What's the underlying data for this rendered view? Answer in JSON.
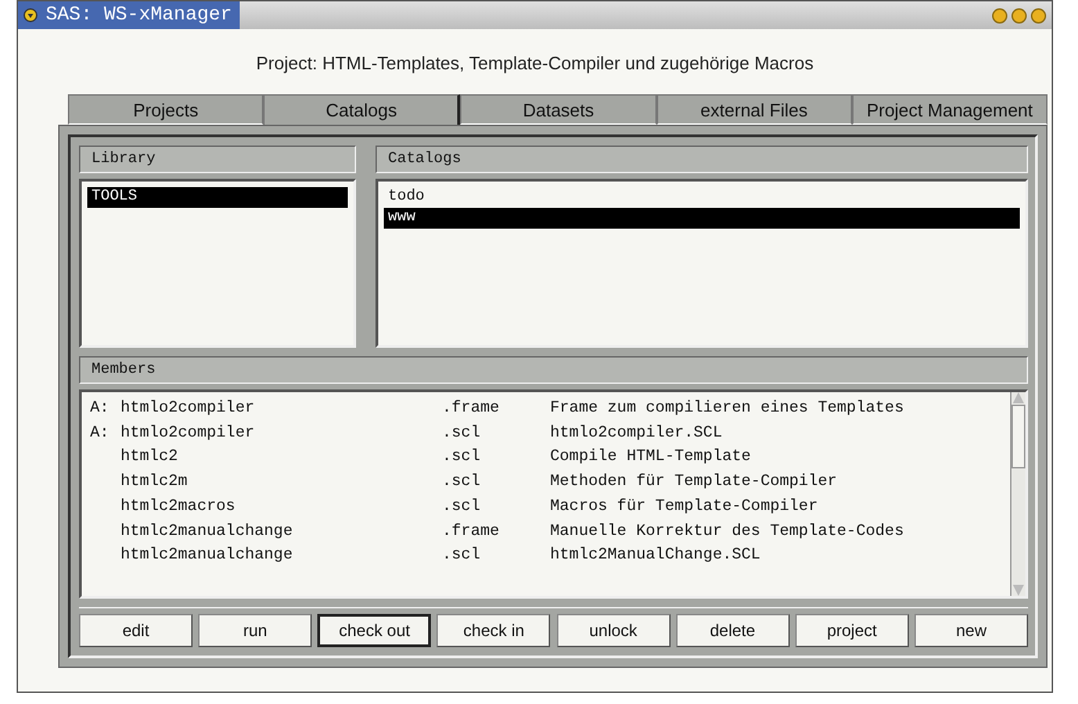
{
  "window": {
    "title": "SAS: WS-xManager"
  },
  "project_label": "Project: HTML-Templates, Template-Compiler und zugehörige Macros",
  "tabs": [
    {
      "label": "Projects",
      "selected": false
    },
    {
      "label": "Catalogs",
      "selected": true
    },
    {
      "label": "Datasets",
      "selected": false
    },
    {
      "label": "external Files",
      "selected": false
    },
    {
      "label": "Project Management",
      "selected": false
    }
  ],
  "library": {
    "header": "Library",
    "items": [
      {
        "label": "TOOLS",
        "selected": true
      }
    ]
  },
  "catalogs": {
    "header": "Catalogs",
    "items": [
      {
        "label": "todo",
        "selected": false
      },
      {
        "label": "www",
        "selected": true
      }
    ]
  },
  "members": {
    "header": "Members",
    "rows": [
      {
        "flag": "A:",
        "name": "htmlo2compiler",
        "type": ".frame",
        "description": "Frame zum compilieren eines Templates"
      },
      {
        "flag": "A:",
        "name": "htmlo2compiler",
        "type": ".scl",
        "description": "htmlo2compiler.SCL"
      },
      {
        "name": "htmlc2",
        "type": ".scl",
        "description": "Compile HTML-Template"
      },
      {
        "name": "htmlc2m",
        "type": ".scl",
        "description": "Methoden für Template-Compiler"
      },
      {
        "name": "htmlc2macros",
        "type": ".scl",
        "description": "Macros für Template-Compiler"
      },
      {
        "name": "htmlc2manualchange",
        "type": ".frame",
        "description": "Manuelle Korrektur des Template-Codes"
      },
      {
        "name": "htmlc2manualchange",
        "type": ".scl",
        "description": "htmlc2ManualChange.SCL"
      }
    ]
  },
  "buttons": [
    {
      "label": "edit",
      "focused": false
    },
    {
      "label": "run",
      "focused": false
    },
    {
      "label": "check out",
      "focused": true
    },
    {
      "label": "check in",
      "focused": false
    },
    {
      "label": "unlock",
      "focused": false
    },
    {
      "label": "delete",
      "focused": false
    },
    {
      "label": "project",
      "focused": false
    },
    {
      "label": "new",
      "focused": false
    }
  ]
}
